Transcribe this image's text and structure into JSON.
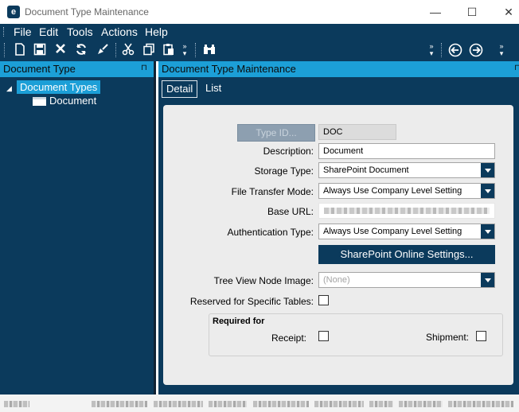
{
  "window": {
    "title": "Document Type Maintenance",
    "logo_letter": "e",
    "controls": {
      "minimize": "—",
      "maximize": "☐",
      "close": "✕"
    }
  },
  "menu": [
    "File",
    "Edit",
    "Tools",
    "Actions",
    "Help"
  ],
  "toolbar": {
    "icons": [
      "new-icon",
      "save-icon",
      "delete-icon",
      "refresh-icon",
      "clear-icon",
      "cut-icon",
      "copy-icon",
      "paste-icon",
      "overflow-icon",
      "binoculars-icon",
      "overflow-icon",
      "back-icon",
      "forward-icon",
      "overflow-icon"
    ]
  },
  "left_pane": {
    "header": "Document Type",
    "pin": "⊓",
    "tree": {
      "root": "Document Types",
      "child": "Document"
    }
  },
  "right_pane": {
    "header": "Document Type Maintenance",
    "pin": "⊓",
    "tabs": {
      "detail": "Detail",
      "list": "List"
    }
  },
  "form": {
    "type_id_button": "Type ID...",
    "type_id_value": "DOC",
    "description": {
      "label": "Description:",
      "value": "Document"
    },
    "storage_type": {
      "label": "Storage Type:",
      "value": "SharePoint Document"
    },
    "file_transfer_mode": {
      "label": "File Transfer Mode:",
      "value": "Always Use Company Level Setting"
    },
    "base_url": {
      "label": "Base URL:"
    },
    "authentication_type": {
      "label": "Authentication Type:",
      "value": "Always Use Company Level Setting"
    },
    "sharepoint_button": "SharePoint Online Settings...",
    "tree_view_node_image": {
      "label": "Tree View Node Image:",
      "value": "(None)"
    },
    "reserved": {
      "label": "Reserved for Specific Tables:",
      "checked": false
    },
    "required_for": {
      "title": "Required for",
      "receipt": {
        "label": "Receipt:",
        "checked": false
      },
      "shipment": {
        "label": "Shipment:",
        "checked": false
      }
    }
  },
  "colors": {
    "primary": "#0b3a5c",
    "accent": "#1c9fd7",
    "panel": "#ececec"
  }
}
